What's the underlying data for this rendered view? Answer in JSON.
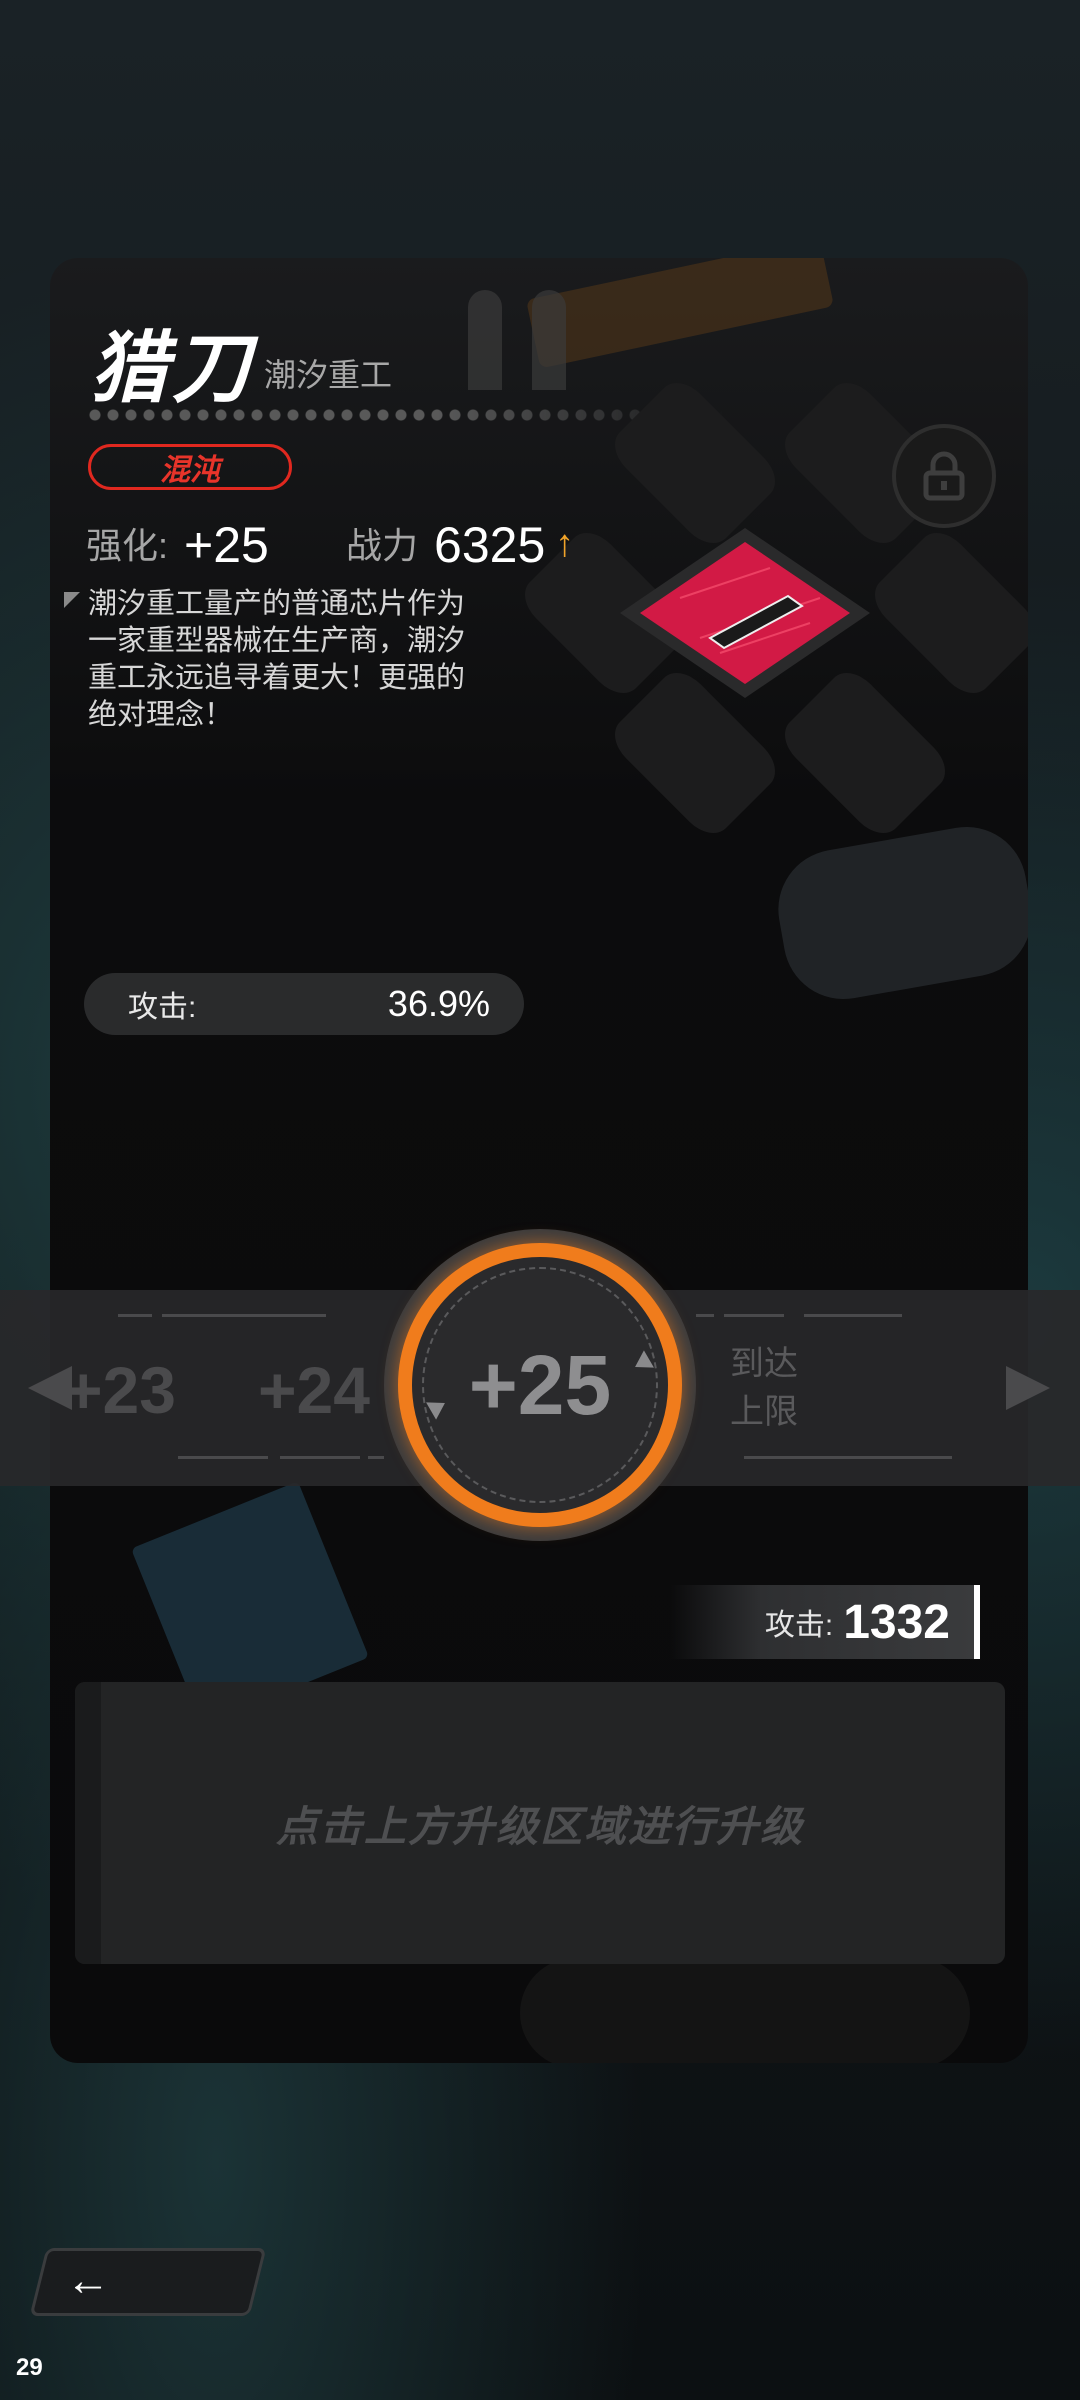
{
  "item": {
    "name": "猎刀",
    "maker": "潮汐重工",
    "rarity": "混沌",
    "enhance_label": "强化:",
    "enhance_value": "+25",
    "power_label": "战力",
    "power_value": "6325",
    "description": "潮汐重工量产的普通芯片作为一家重型器械在生产商，潮汐重工永远追寻着更大！更强的绝对理念！"
  },
  "attribute": {
    "label": "攻击:",
    "value": "36.9%"
  },
  "level_selector": {
    "prev2": "+23",
    "prev1": "+24",
    "current": "+25",
    "next_line1": "到达",
    "next_line2": "上限"
  },
  "attack_total": {
    "label": "攻击:",
    "value": "1332"
  },
  "upgrade_hint": "点击上方升级区域进行升级",
  "debug": {
    "fps": "29"
  },
  "colors": {
    "accent": "#f07c1c",
    "rarity": "#e8342a",
    "chip": "#d21a45"
  }
}
